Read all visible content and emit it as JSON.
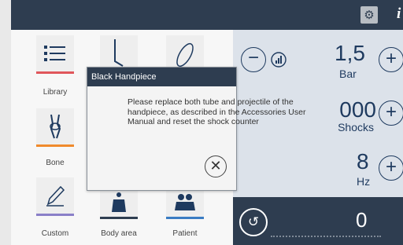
{
  "header": {
    "settings_icon": "gear-icon",
    "info_label": "i"
  },
  "categories": [
    {
      "label": "Library",
      "icon": "list-icon",
      "accent": "#e0565b"
    },
    {
      "label": "Bone",
      "icon": "knee-icon",
      "accent": "#f08a2c"
    },
    {
      "label": "Custom",
      "icon": "pencil-icon",
      "accent": "#8a7fc8"
    },
    {
      "label": "Body area",
      "icon": "body-icon",
      "accent": "#2e3d50"
    },
    {
      "label": "Patient",
      "icon": "patients-icon",
      "accent": "#3a7cc3"
    }
  ],
  "controls": {
    "pressure": {
      "value": "1,5",
      "unit": "Bar"
    },
    "shocks": {
      "value": "000",
      "unit": "Shocks"
    },
    "frequency": {
      "value": "8",
      "unit": "Hz"
    },
    "counter": {
      "value": "0"
    }
  },
  "dialog": {
    "title": "Black Handpiece",
    "message": "Please replace both tube and projectile of the handpiece, as described in the Accessories User Manual and reset the shock counter"
  },
  "colors": {
    "topbar": "#2e3d50",
    "right_panel": "#dce2ea",
    "accent_navy": "#1e3a5f"
  }
}
